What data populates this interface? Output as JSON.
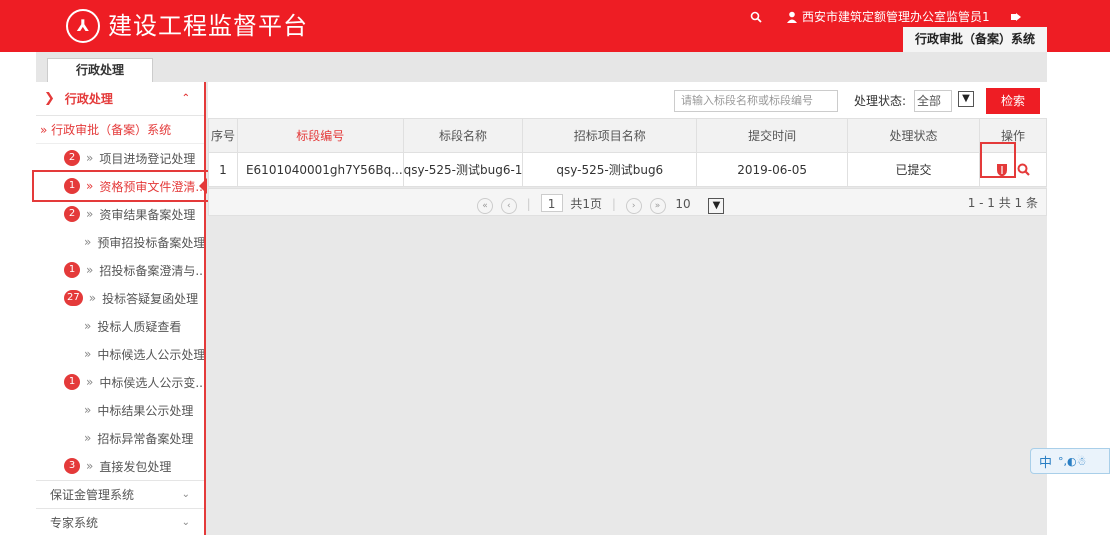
{
  "header": {
    "logo_text": "⅄",
    "title": "建设工程监督平台",
    "user": "西安市建筑定额管理办公室监管员1",
    "system_tab": "行政审批（备案）系统"
  },
  "tabs": [
    {
      "label": "行政处理"
    }
  ],
  "sidebar": {
    "head": "行政处理",
    "sub": "» 行政审批（备案）系统",
    "items": [
      {
        "badge": "2",
        "label": "项目进场登记处理"
      },
      {
        "badge": "1",
        "label": "资格预审文件澄清..."
      },
      {
        "badge": "2",
        "label": "资审结果备案处理"
      },
      {
        "badge": "",
        "label": "预审招投标备案处理"
      },
      {
        "badge": "1",
        "label": "招投标备案澄清与..."
      },
      {
        "badge": "27",
        "label": "投标答疑复函处理"
      },
      {
        "badge": "",
        "label": "投标人质疑查看"
      },
      {
        "badge": "",
        "label": "中标候选人公示处理"
      },
      {
        "badge": "1",
        "label": "中标侯选人公示变..."
      },
      {
        "badge": "",
        "label": "中标结果公示处理"
      },
      {
        "badge": "",
        "label": "招标异常备案处理"
      },
      {
        "badge": "3",
        "label": "直接发包处理"
      }
    ],
    "foot": [
      {
        "label": "保证金管理系统"
      },
      {
        "label": "专家系统"
      }
    ]
  },
  "filter": {
    "search_placeholder": "请输入标段名称或标段编号",
    "status_label": "处理状态:",
    "status_value": "全部",
    "search_button": "检索"
  },
  "table": {
    "headers": [
      "序号",
      "标段编号",
      "标段名称",
      "招标项目名称",
      "提交时间",
      "处理状态",
      "操作"
    ],
    "rows": [
      {
        "no": "1",
        "code": "E6101040001gh7Y56Bq...",
        "name": "qsy-525-测试bug6-1",
        "project": "qsy-525-测试bug6",
        "time": "2019-06-05",
        "status": "已提交"
      }
    ]
  },
  "pager": {
    "page": "1",
    "total_pages": "共1页",
    "page_size": "10",
    "summary": "1 - 1  共 1 条"
  },
  "ime": {
    "label": "中"
  },
  "colors": {
    "brand": "#ee1d24",
    "accent": "#e43a3a"
  }
}
